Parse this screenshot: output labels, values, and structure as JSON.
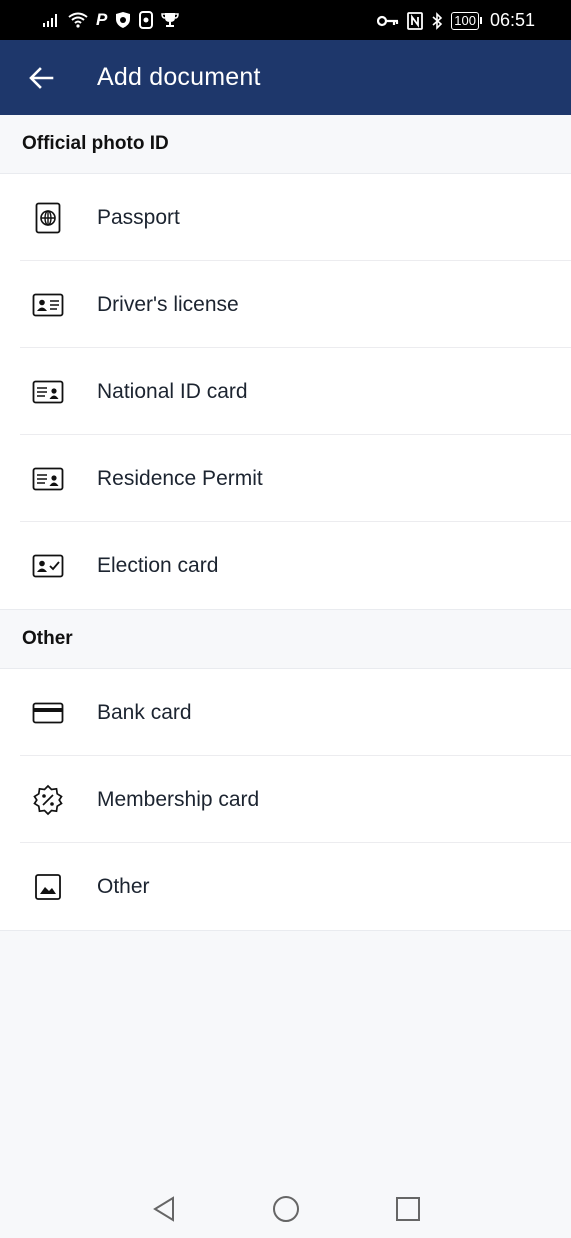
{
  "status_bar": {
    "time": "06:51",
    "battery": "100",
    "icons_left": [
      "signal-icon",
      "wifi-icon",
      "parking-icon",
      "shield-icon",
      "phone-icon",
      "trophy-icon"
    ],
    "icons_right": [
      "key-icon",
      "nfc-icon",
      "bluetooth-icon",
      "battery-icon"
    ]
  },
  "app_bar": {
    "title": "Add document",
    "back_icon": "arrow-left-icon"
  },
  "sections": [
    {
      "title": "Official photo ID",
      "items": [
        {
          "label": "Passport",
          "icon": "passport-icon"
        },
        {
          "label": "Driver's license",
          "icon": "drivers-license-icon"
        },
        {
          "label": "National ID card",
          "icon": "national-id-icon"
        },
        {
          "label": "Residence Permit",
          "icon": "residence-permit-icon"
        },
        {
          "label": "Election card",
          "icon": "election-card-icon"
        }
      ]
    },
    {
      "title": "Other",
      "items": [
        {
          "label": "Bank card",
          "icon": "bank-card-icon"
        },
        {
          "label": "Membership card",
          "icon": "membership-badge-icon"
        },
        {
          "label": "Other",
          "icon": "image-icon"
        }
      ]
    }
  ],
  "nav_bar": {
    "buttons": [
      "back-triangle-icon",
      "home-circle-icon",
      "recents-square-icon"
    ]
  },
  "colors": {
    "app_bar": "#1e376b",
    "background": "#f7f8fa",
    "list_background": "#ffffff",
    "text": "#1c2430"
  }
}
